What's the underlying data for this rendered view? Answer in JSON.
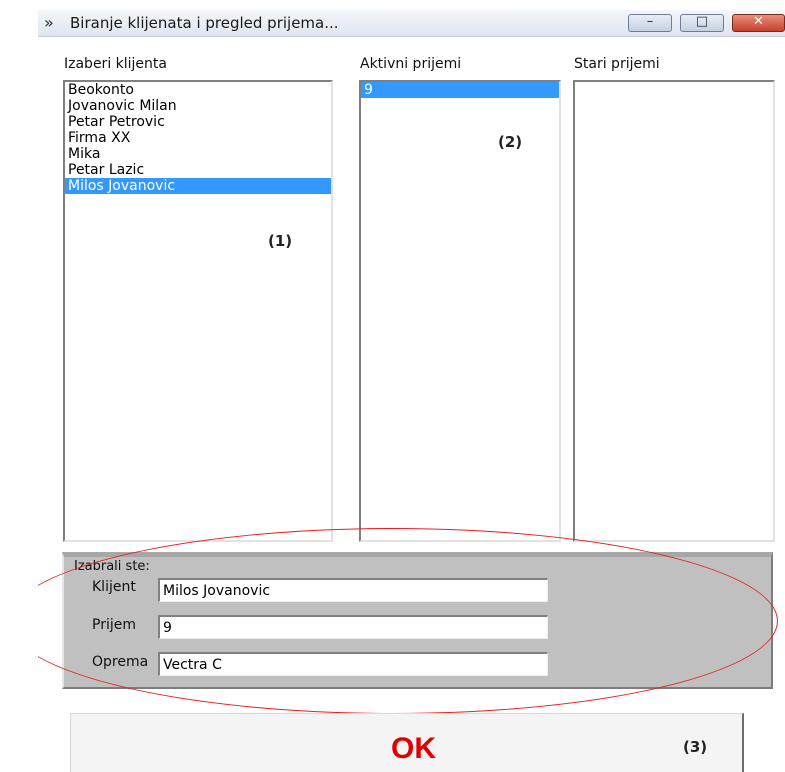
{
  "window": {
    "title": "Biranje klijenata i pregled prijema..."
  },
  "columns": {
    "clients_label": "Izaberi klijenta",
    "active_label": "Aktivni prijemi",
    "old_label": "Stari prijemi"
  },
  "clients": [
    "Beokonto",
    "Jovanovic Milan",
    "Petar Petrovic",
    "Firma XX",
    "Mika",
    "Petar Lazic",
    "Milos Jovanovic"
  ],
  "clients_selected": "Milos Jovanovic",
  "active_receptions": [
    "9"
  ],
  "active_selected": "9",
  "old_receptions": [],
  "markers": {
    "one": "(1)",
    "two": "(2)",
    "three": "(3)"
  },
  "selection": {
    "legend": "Izabrali ste:",
    "client_label": "Klijent",
    "client_value": "Milos Jovanovic",
    "reception_label": "Prijem",
    "reception_value": "9",
    "equipment_label": "Oprema",
    "equipment_value": "Vectra C"
  },
  "ok_button": {
    "label": "OK"
  },
  "colors": {
    "selection": "#3399ff",
    "ok_text": "#e00000",
    "annotation": "#e62020"
  }
}
